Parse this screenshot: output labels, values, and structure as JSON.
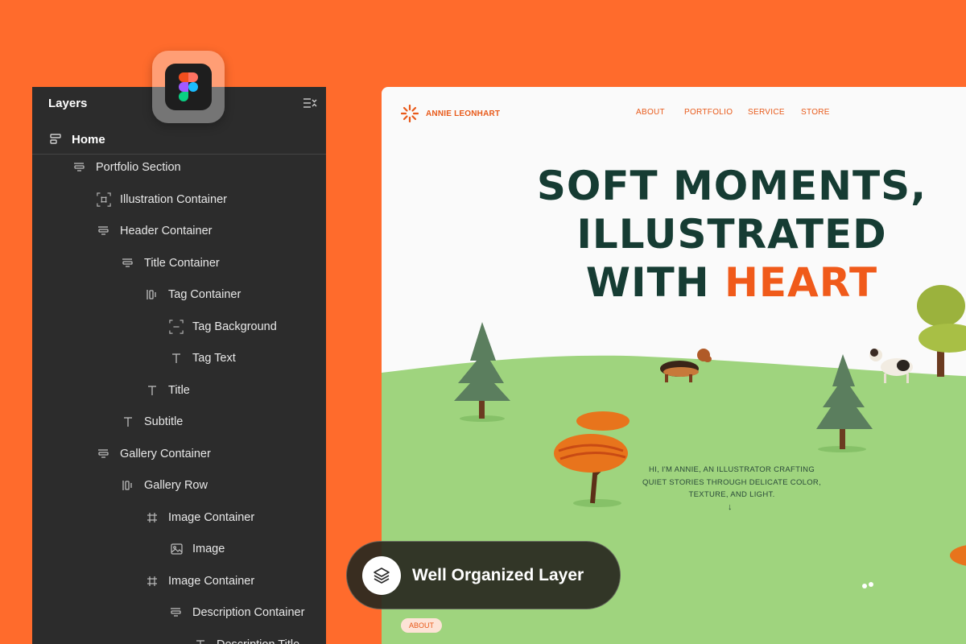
{
  "layers_panel": {
    "title": "Layers",
    "home_label": "Home",
    "items": [
      {
        "label": "Portfolio Section",
        "icon": "auto-layout-icon"
      },
      {
        "label": "Illustration Container",
        "icon": "frame-icon"
      },
      {
        "label": "Header Container",
        "icon": "auto-layout-icon"
      },
      {
        "label": "Title Container",
        "icon": "auto-layout-icon"
      },
      {
        "label": "Tag Container",
        "icon": "horizontal-layout-icon"
      },
      {
        "label": "Tag Background",
        "icon": "rectangle-icon"
      },
      {
        "label": "Tag Text",
        "icon": "text-icon"
      },
      {
        "label": "Title",
        "icon": "text-icon"
      },
      {
        "label": "Subtitle",
        "icon": "text-icon"
      },
      {
        "label": "Gallery Container",
        "icon": "auto-layout-icon"
      },
      {
        "label": "Gallery Row",
        "icon": "horizontal-layout-icon"
      },
      {
        "label": "Image Container",
        "icon": "frame-hash-icon"
      },
      {
        "label": "Image",
        "icon": "image-icon"
      },
      {
        "label": "Image Container",
        "icon": "frame-hash-icon"
      },
      {
        "label": "Description Container",
        "icon": "auto-layout-icon"
      },
      {
        "label": "Description Title",
        "icon": "text-icon"
      }
    ]
  },
  "preview": {
    "brand": "ANNIE LEONHART",
    "nav": [
      "ABOUT",
      "PORTFOLIO",
      "SERVICE",
      "STORE"
    ],
    "hero": {
      "line1": "SOFT MOMENTS,",
      "line2": "ILLUSTRATED",
      "line3_prefix": "WITH ",
      "line3_accent": "HEART"
    },
    "intro": "HI, I'M ANNIE, AN ILLUSTRATOR CRAFTING QUIET STORIES THROUGH DELICATE COLOR, TEXTURE, AND LIGHT.",
    "arrow": "↓",
    "about_tag": "ABOUT"
  },
  "badge": {
    "text": "Well Organized Layer",
    "icon": "layers-icon"
  },
  "colors": {
    "background": "#ff6b2c",
    "panel": "#2c2c2c",
    "accent": "#f05a1a",
    "heading": "#163c33",
    "grass": "#9fd47e"
  }
}
